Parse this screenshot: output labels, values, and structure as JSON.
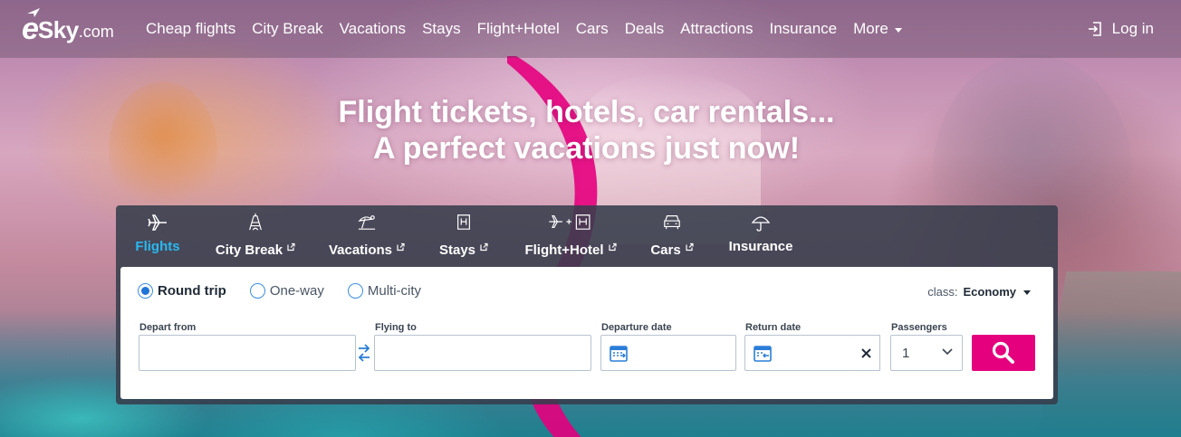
{
  "brand": {
    "logo_e": "e",
    "logo_sky": "Sky",
    "logo_com": ".com",
    "accent": "#e5007e",
    "active_tab_color": "#29b8f0"
  },
  "nav": {
    "items": [
      "Cheap flights",
      "City Break",
      "Vacations",
      "Stays",
      "Flight+Hotel",
      "Cars",
      "Deals",
      "Attractions",
      "Insurance",
      "More"
    ],
    "login_label": "Log in"
  },
  "headline": {
    "line1": "Flight tickets, hotels, car rentals...",
    "line2": "A perfect vacations just now!"
  },
  "tabs": [
    {
      "label": "Flights",
      "icon": "plane-icon",
      "active": true,
      "external": false
    },
    {
      "label": "City Break",
      "icon": "eiffel-tower-icon",
      "active": false,
      "external": true
    },
    {
      "label": "Vacations",
      "icon": "beach-umbrella-icon",
      "active": false,
      "external": true
    },
    {
      "label": "Stays",
      "icon": "hotel-icon",
      "active": false,
      "external": true
    },
    {
      "label": "Flight+Hotel",
      "icon": "plane-hotel-icon",
      "active": false,
      "external": true
    },
    {
      "label": "Cars",
      "icon": "car-icon",
      "active": false,
      "external": true
    },
    {
      "label": "Insurance",
      "icon": "umbrella-icon",
      "active": false,
      "external": false
    }
  ],
  "trip_type": {
    "options": [
      "Round trip",
      "One-way",
      "Multi-city"
    ],
    "selected": "Round trip"
  },
  "cabin_class": {
    "label": "class:",
    "value": "Economy"
  },
  "fields": {
    "depart_from": {
      "label": "Depart from",
      "value": ""
    },
    "flying_to": {
      "label": "Flying to",
      "value": ""
    },
    "departure_date": {
      "label": "Departure date",
      "value": ""
    },
    "return_date": {
      "label": "Return date",
      "value": ""
    },
    "passengers": {
      "label": "Passengers",
      "value": "1"
    }
  }
}
